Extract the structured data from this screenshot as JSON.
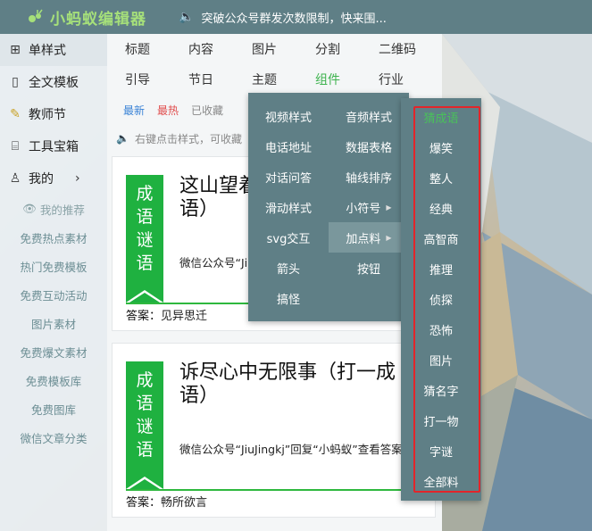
{
  "app": {
    "name": "小蚂蚁编辑器",
    "notice": "突破公众号群发次数限制，快来围..."
  },
  "sidebar": {
    "items": [
      {
        "label": "单样式",
        "icon": "grid-icon"
      },
      {
        "label": "全文模板",
        "icon": "template-icon"
      },
      {
        "label": "教师节",
        "icon": "ribbon-icon"
      },
      {
        "label": "工具宝箱",
        "icon": "toolbox-icon"
      },
      {
        "label": "我的",
        "icon": "user-icon",
        "arrow": "›"
      }
    ],
    "sub_title": "我的推荐",
    "sub_items": [
      "免费热点素材",
      "热门免费模板",
      "免费互动活动",
      "图片素材",
      "免费爆文素材",
      "免费模板库",
      "免费图库",
      "微信文章分类"
    ]
  },
  "nav": {
    "row1": [
      "标题",
      "内容",
      "图片",
      "分割",
      "二维码"
    ],
    "row2": [
      "引导",
      "节日",
      "主题",
      "组件",
      "行业"
    ],
    "filters": {
      "new": "最新",
      "hot": "最热",
      "fav": "已收藏"
    },
    "hint": "右键点击样式，可收藏"
  },
  "cards": [
    {
      "tag": [
        "成",
        "语",
        "谜",
        "语"
      ],
      "question": "这山望着那山高（打一成语）",
      "source": "微信公众号“JiuJingkj”回复“小蚂蚁”查看答案",
      "answer_key": "答案：",
      "answer": "见异思迁"
    },
    {
      "tag": [
        "成",
        "语",
        "谜",
        "语"
      ],
      "question": "诉尽心中无限事（打一成语）",
      "source": "微信公众号“JiuJingkj”回复“小蚂蚁”查看答案",
      "answer_key": "答案：",
      "answer": "畅所欲言"
    }
  ],
  "menu1": [
    [
      "视频样式",
      "音频样式"
    ],
    [
      "电话地址",
      "数据表格"
    ],
    [
      "对话问答",
      "轴线排序"
    ],
    [
      "滑动样式",
      "小符号"
    ],
    [
      "svg交互",
      "加点料"
    ],
    [
      "箭头",
      "按钮"
    ],
    [
      "搞怪",
      ""
    ]
  ],
  "menu2": [
    "猜成语",
    "爆笑",
    "整人",
    "经典",
    "高智商",
    "推理",
    "侦探",
    "恐怖",
    "图片",
    "猜名字",
    "打一物",
    "字谜",
    "全部料"
  ],
  "colors": {
    "topbar": "#5f7f86",
    "logo": "#a6e07a",
    "accent_green": "#1fb140",
    "highlight_red": "#e3252a"
  }
}
